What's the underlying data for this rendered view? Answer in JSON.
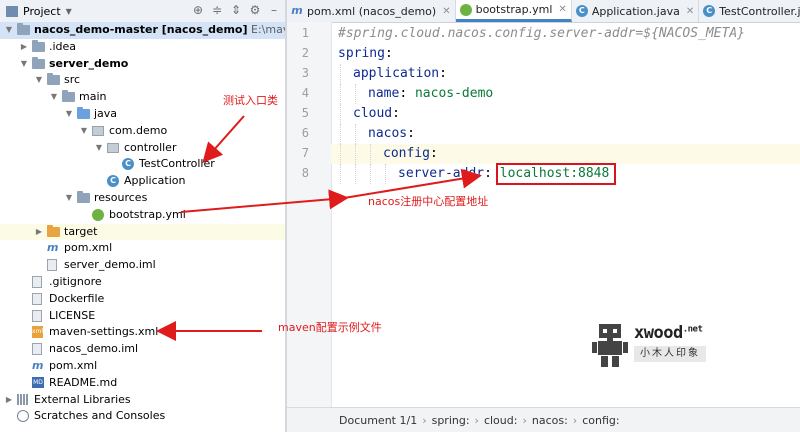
{
  "project_panel": {
    "title": "Project",
    "tree": [
      {
        "name": "nacos_demo-master",
        "badge": "[nacos_demo]",
        "path": "E:\\maven-ws\\na",
        "icon": "folder",
        "depth": 0,
        "arrow": "down",
        "bold": true,
        "selected": true
      },
      {
        "name": ".idea",
        "icon": "folder",
        "depth": 1,
        "arrow": "right"
      },
      {
        "name": "server_demo",
        "icon": "folder-module",
        "depth": 1,
        "arrow": "down",
        "bold": true
      },
      {
        "name": "src",
        "icon": "folder",
        "depth": 2,
        "arrow": "down"
      },
      {
        "name": "main",
        "icon": "folder",
        "depth": 3,
        "arrow": "down"
      },
      {
        "name": "java",
        "icon": "folder-source",
        "depth": 4,
        "arrow": "down"
      },
      {
        "name": "com.demo",
        "icon": "package",
        "depth": 5,
        "arrow": "down"
      },
      {
        "name": "controller",
        "icon": "package",
        "depth": 6,
        "arrow": "down"
      },
      {
        "name": "TestController",
        "icon": "java-class",
        "depth": 7,
        "arrow": ""
      },
      {
        "name": "Application",
        "icon": "spring-class",
        "depth": 6,
        "arrow": ""
      },
      {
        "name": "resources",
        "icon": "folder",
        "depth": 4,
        "arrow": "down"
      },
      {
        "name": "bootstrap.yml",
        "icon": "yml-file",
        "depth": 5,
        "arrow": ""
      },
      {
        "name": "target",
        "icon": "folder-excluded",
        "depth": 2,
        "arrow": "right",
        "highlight": true
      },
      {
        "name": "pom.xml",
        "icon": "maven-file",
        "depth": 2,
        "arrow": ""
      },
      {
        "name": "server_demo.iml",
        "icon": "iml-file",
        "depth": 2,
        "arrow": ""
      },
      {
        "name": ".gitignore",
        "icon": "file",
        "depth": 1,
        "arrow": ""
      },
      {
        "name": "Dockerfile",
        "icon": "file",
        "depth": 1,
        "arrow": ""
      },
      {
        "name": "LICENSE",
        "icon": "file",
        "depth": 1,
        "arrow": ""
      },
      {
        "name": "maven-settings.xml",
        "icon": "xml-file",
        "depth": 1,
        "arrow": ""
      },
      {
        "name": "nacos_demo.iml",
        "icon": "iml-file",
        "depth": 1,
        "arrow": ""
      },
      {
        "name": "pom.xml",
        "icon": "maven-file",
        "depth": 1,
        "arrow": ""
      },
      {
        "name": "README.md",
        "icon": "md-file",
        "depth": 1,
        "arrow": ""
      },
      {
        "name": "External Libraries",
        "icon": "library",
        "depth": 0,
        "arrow": "right"
      },
      {
        "name": "Scratches and Consoles",
        "icon": "scratch",
        "depth": 0,
        "arrow": ""
      }
    ]
  },
  "tabs": [
    {
      "label": "pom.xml (nacos_demo)",
      "icon": "maven-file",
      "active": false
    },
    {
      "label": "bootstrap.yml",
      "icon": "yml-file",
      "active": true
    },
    {
      "label": "Application.java",
      "icon": "java-class",
      "active": false
    },
    {
      "label": "TestController.java",
      "icon": "java-class",
      "active": false
    }
  ],
  "code_lines": [
    {
      "n": "1",
      "indent": 0,
      "parts": [
        {
          "t": "#spring.cloud.nacos.config.server-addr=${NACOS_META}",
          "c": "comment"
        }
      ]
    },
    {
      "n": "2",
      "indent": 0,
      "parts": [
        {
          "t": "spring",
          "c": "key"
        },
        {
          "t": ":",
          "c": ""
        }
      ]
    },
    {
      "n": "3",
      "indent": 1,
      "parts": [
        {
          "t": "application",
          "c": "key"
        },
        {
          "t": ":",
          "c": ""
        }
      ]
    },
    {
      "n": "4",
      "indent": 2,
      "parts": [
        {
          "t": "name",
          "c": "key"
        },
        {
          "t": ": ",
          "c": ""
        },
        {
          "t": "nacos-demo",
          "c": "val"
        }
      ]
    },
    {
      "n": "5",
      "indent": 1,
      "parts": [
        {
          "t": "cloud",
          "c": "key"
        },
        {
          "t": ":",
          "c": ""
        }
      ]
    },
    {
      "n": "6",
      "indent": 2,
      "parts": [
        {
          "t": "nacos",
          "c": "key"
        },
        {
          "t": ":",
          "c": ""
        }
      ]
    },
    {
      "n": "7",
      "indent": 3,
      "parts": [
        {
          "t": "config",
          "c": "key"
        },
        {
          "t": ":",
          "c": ""
        }
      ],
      "current": true
    },
    {
      "n": "8",
      "indent": 4,
      "parts": [
        {
          "t": "server-addr",
          "c": "key"
        },
        {
          "t": ": ",
          "c": ""
        },
        {
          "t": "localhost:8848",
          "c": "val"
        }
      ]
    }
  ],
  "status": {
    "document": "Document 1/1",
    "breadcrumb": [
      "spring:",
      "cloud:",
      "nacos:",
      "config:"
    ]
  },
  "annotations": {
    "test_entry": "测试入口类",
    "nacos_addr": "nacos注册中心配置地址",
    "maven_settings": "maven配置示例文件"
  },
  "watermark": {
    "brand": "xwood",
    "brand_tld": ".net",
    "subtitle": "小木人印象"
  },
  "colors": {
    "accent": "#4083c9",
    "annotation": "#e01b1b",
    "selection": "#d5e3f7"
  }
}
